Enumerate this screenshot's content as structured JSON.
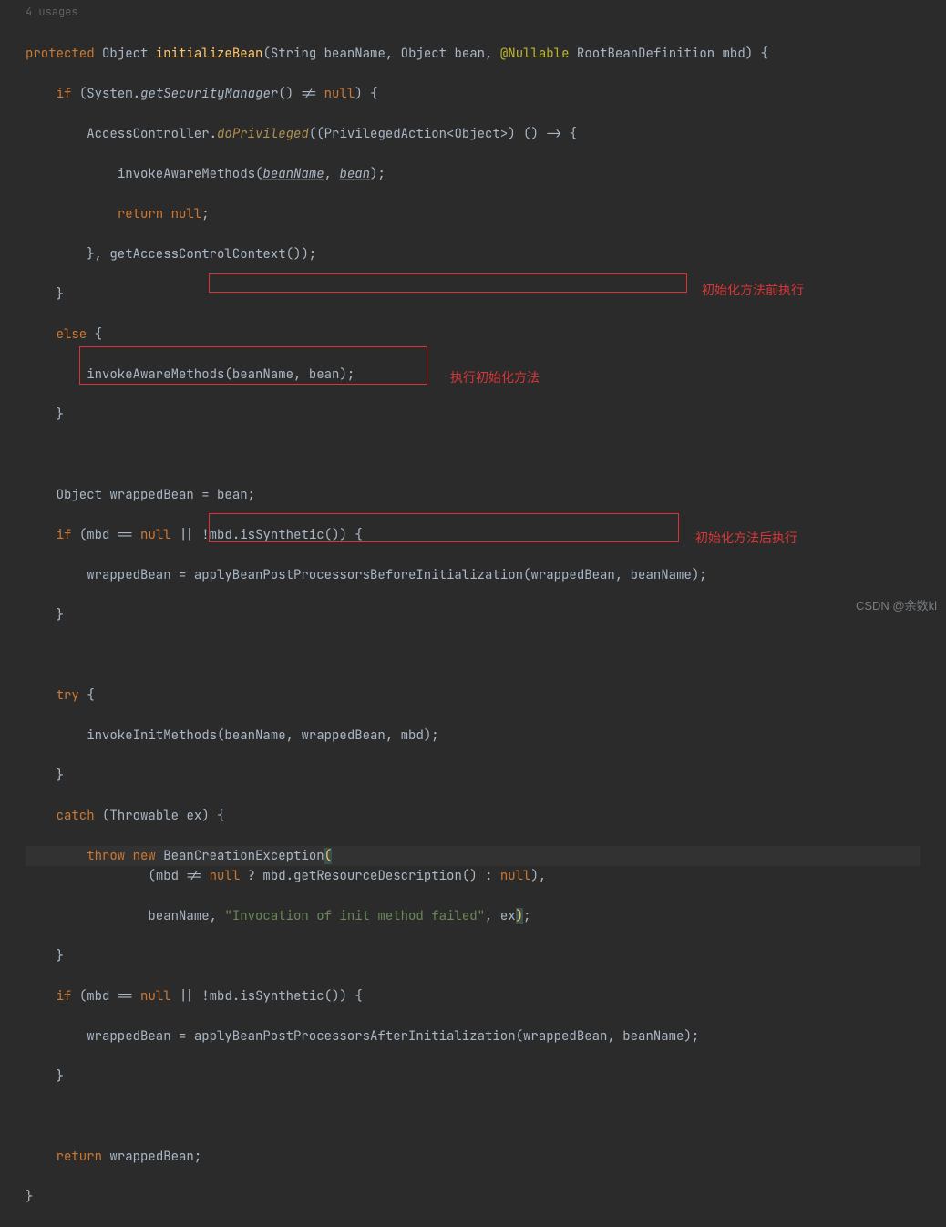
{
  "usages_label": "4 usages",
  "code": {
    "l1_protected": "protected",
    "l1_type1": "Object",
    "l1_method": "initializeBean",
    "l1_p1t": "String",
    "l1_p1n": "beanName",
    "l1_p2t": "Object",
    "l1_p2n": "bean",
    "l1_annot": "@Nullable",
    "l1_p3t": "RootBeanDefinition",
    "l1_p3n": "mbd",
    "l2_if": "if",
    "l2_system": "System",
    "l2_gsm": "getSecurityManager",
    "l2_null": "null",
    "l3_ac": "AccessController",
    "l3_method": "doPrivileged",
    "l3_pa": "PrivilegedAction",
    "l3_obj": "Object",
    "l4_invoke": "invokeAwareMethods",
    "l4_bn": "beanName",
    "l4_bean": "bean",
    "l5_return": "return",
    "l5_null": "null",
    "l6_gacc": "getAccessControlContext",
    "l8_else": "else",
    "l9_invoke": "invokeAwareMethods",
    "l9_bn": "beanName",
    "l9_bean": "bean",
    "l12_obj": "Object",
    "l12_wb": "wrappedBean",
    "l12_bean": "bean",
    "l13_if": "if",
    "l13_mbd": "mbd",
    "l13_null": "null",
    "l13_issyn": "isSynthetic",
    "l14_wb": "wrappedBean",
    "l14_method": "applyBeanPostProcessorsBeforeInitialization",
    "l14_wb2": "wrappedBean",
    "l14_bn": "beanName",
    "l17_try": "try",
    "l18_method": "invokeInitMethods",
    "l18_bn": "beanName",
    "l18_wb": "wrappedBean",
    "l18_mbd": "mbd",
    "l20_catch": "catch",
    "l20_t": "Throwable",
    "l20_ex": "ex",
    "l21_throw": "throw",
    "l21_new": "new",
    "l21_bce": "BeanCreationException",
    "l22_mbd": "mbd",
    "l22_null": "null",
    "l22_grd": "getResourceDescription",
    "l22_null2": "null",
    "l23_bn": "beanName",
    "l23_str": "\"Invocation of init method failed\"",
    "l23_ex": "ex",
    "l25_if": "if",
    "l25_mbd": "mbd",
    "l25_null": "null",
    "l25_issyn": "isSynthetic",
    "l26_wb": "wrappedBean",
    "l26_method": "applyBeanPostProcessorsAfterInitialization",
    "l26_wb2": "wrappedBean",
    "l26_bn": "beanName",
    "l29_return": "return",
    "l29_wb": "wrappedBean"
  },
  "annotations": {
    "before_init": "初始化方法前执行",
    "exec_init": "执行初始化方法",
    "after_init": "初始化方法后执行"
  },
  "watermark": "CSDN @余数kl"
}
